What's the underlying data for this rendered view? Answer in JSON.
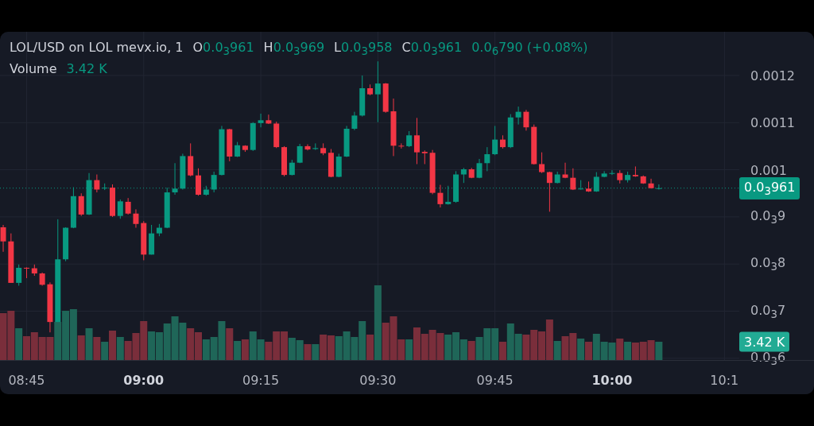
{
  "legend": {
    "title": "LOL/USD on LOL mevx.io, 1",
    "fields": [
      {
        "label": "O",
        "value": "0.0$_{3}$961"
      },
      {
        "label": "H",
        "value": "0.0$_{3}$969"
      },
      {
        "label": "L",
        "value": "0.0$_{3}$958"
      },
      {
        "label": "C",
        "value": "0.0$_{3}$961"
      }
    ],
    "change": "0.0$_{6}$790 (+0.08%)",
    "volume_label": "Volume",
    "volume_value": "3.42 K"
  },
  "price_axis": {
    "labels": [
      "0.0012",
      "0.0011",
      "0.001",
      "0.0$_{3}$9",
      "0.0$_{3}$8",
      "0.0$_{3}$7",
      "0.0$_{3}$6"
    ],
    "price_tag": "0.0$_{3}$961",
    "volume_tag": "3.42 K"
  },
  "time_axis": {
    "labels": [
      {
        "text": "08:45",
        "bold": false
      },
      {
        "text": "09:00",
        "bold": true
      },
      {
        "text": "09:15",
        "bold": false
      },
      {
        "text": "09:30",
        "bold": false
      },
      {
        "text": "09:45",
        "bold": false
      },
      {
        "text": "10:00",
        "bold": true
      },
      {
        "text": "10:1",
        "bold": false
      }
    ]
  }
}
